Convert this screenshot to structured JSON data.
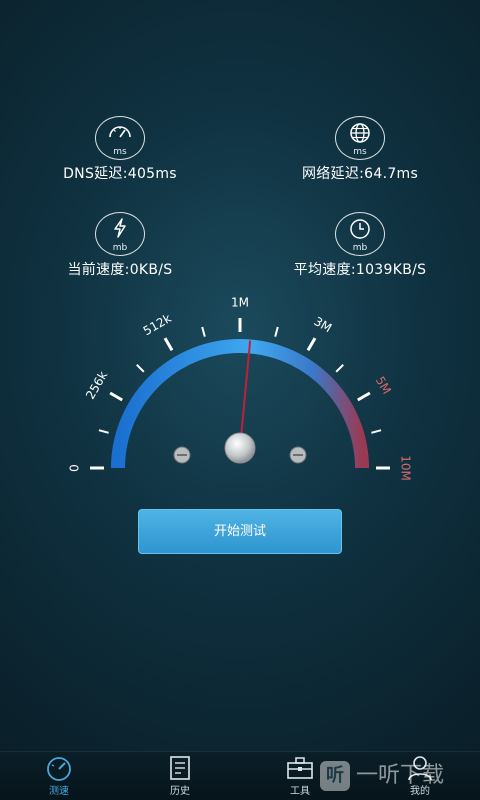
{
  "stats": {
    "dns": {
      "unit": "ms",
      "text": "DNS延迟:405ms",
      "icon": "speedometer-icon"
    },
    "network": {
      "unit": "ms",
      "text": "网络延迟:64.7ms",
      "icon": "globe-icon"
    },
    "current_speed": {
      "unit": "mb",
      "text": "当前速度:0KB/S",
      "icon": "lightning-icon"
    },
    "avg_speed": {
      "unit": "mb",
      "text": "平均速度:1039KB/S",
      "icon": "clock-icon"
    }
  },
  "gauge": {
    "labels": [
      "0",
      "256k",
      "512k",
      "1M",
      "3M",
      "5M",
      "10M"
    ],
    "needle_position": 0.53,
    "colors": {
      "arc_start": "#1a6fcf",
      "arc_mid": "#3fa8ef",
      "arc_end": "#9a3a52",
      "needle": "#c0203a"
    }
  },
  "start_button": {
    "label": "开始测试"
  },
  "tabs": [
    {
      "label": "测速",
      "icon": "speedometer-icon",
      "active": true
    },
    {
      "label": "历史",
      "icon": "document-icon",
      "active": false
    },
    {
      "label": "工具",
      "icon": "toolbox-icon",
      "active": false
    },
    {
      "label": "我的",
      "icon": "person-icon",
      "active": false
    }
  ],
  "watermark": {
    "glyph": "听",
    "text": "一听下载"
  },
  "colors": {
    "accent": "#49a7da",
    "button": "#3aa3da"
  }
}
